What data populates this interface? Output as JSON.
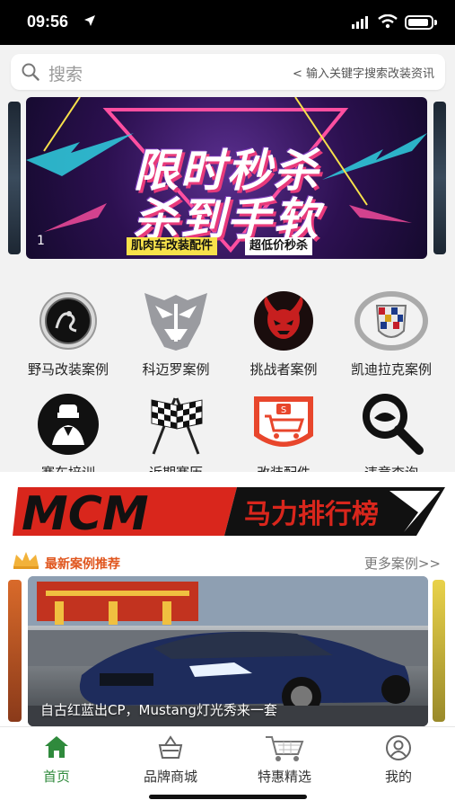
{
  "status": {
    "time": "09:56"
  },
  "search": {
    "placeholder": "搜索",
    "hint": "< 输入关键字搜索改装资讯"
  },
  "banner": {
    "line1": "限时秒杀",
    "line2": "杀到手软",
    "tag1": "肌肉车改装配件",
    "tag2": "超低价秒杀",
    "index": "1"
  },
  "grid": [
    {
      "label": "野马改装案例",
      "icon": "cobra-logo-icon"
    },
    {
      "label": "科迈罗案例",
      "icon": "decepticon-logo-icon"
    },
    {
      "label": "挑战者案例",
      "icon": "demon-logo-icon"
    },
    {
      "label": "凯迪拉克案例",
      "icon": "cadillac-logo-icon"
    },
    {
      "label": "赛车培训",
      "icon": "driver-icon"
    },
    {
      "label": "近期赛历",
      "icon": "checkered-flags-icon"
    },
    {
      "label": "改装配件",
      "icon": "shopping-cart-icon"
    },
    {
      "label": "违章查询",
      "icon": "magnifier-icon"
    }
  ],
  "mcm": {
    "logo": "MCM",
    "text": "马力排行榜"
  },
  "recommend": {
    "title": "最新案例推荐",
    "more": "更多案例>>",
    "caption": "自古红蓝出CP，Mustang灯光秀来一套"
  },
  "tabs": [
    {
      "label": "首页",
      "icon": "home-icon",
      "active": true
    },
    {
      "label": "品牌商城",
      "icon": "basket-icon",
      "active": false
    },
    {
      "label": "特惠精选",
      "icon": "cart-icon",
      "active": false
    },
    {
      "label": "我的",
      "icon": "user-icon",
      "active": false
    }
  ],
  "colors": {
    "accent": "#2f8a3c",
    "recommend": "#e0561e",
    "mcm_red": "#d9261c"
  }
}
